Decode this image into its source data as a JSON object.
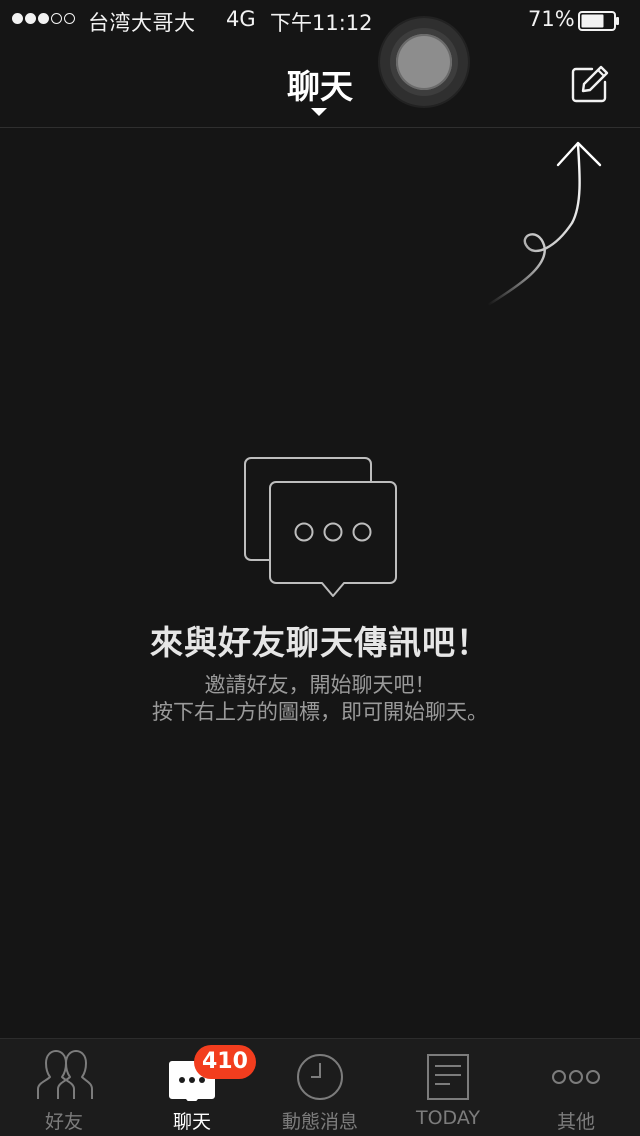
{
  "status_bar": {
    "signal_strength": 3,
    "signal_max": 5,
    "carrier": "台湾大哥大",
    "network": "4G",
    "time": "下午11:12",
    "battery_percent": "71%",
    "battery_level": 0.71
  },
  "header": {
    "title": "聊天",
    "title_dropdown_icon": "caret-down-icon",
    "compose_icon": "compose-icon"
  },
  "empty_state": {
    "icon": "chat-bubbles-icon",
    "title": "來與好友聊天傳訊吧！",
    "line1": "邀請好友，開始聊天吧！",
    "line2": "按下右上方的圖標，即可開始聊天。"
  },
  "tabs": [
    {
      "label": "好友",
      "icon": "friends-icon",
      "active": false
    },
    {
      "label": "聊天",
      "icon": "chat-icon",
      "active": true,
      "badge": "410"
    },
    {
      "label": "動態消息",
      "icon": "clock-icon",
      "active": false
    },
    {
      "label": "TODAY",
      "icon": "news-icon",
      "active": false
    },
    {
      "label": "其他",
      "icon": "more-icon",
      "active": false
    }
  ],
  "colors": {
    "background": "#151515",
    "badge": "#f23d1e",
    "active_tab": "#ffffff",
    "inactive_tab": "#7c7c7c"
  }
}
